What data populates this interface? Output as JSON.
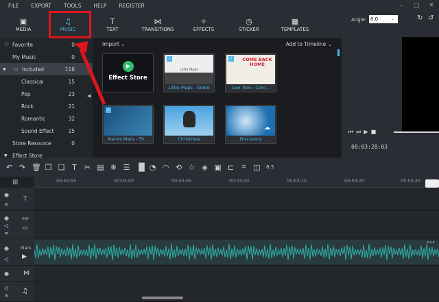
{
  "menu": [
    "FILE",
    "EXPORT",
    "TOOLS",
    "HELP",
    "REGISTER"
  ],
  "window_controls": [
    "minimize-icon",
    "maximize-icon",
    "close-icon"
  ],
  "tabs": [
    {
      "label": "MEDIA",
      "icon": "folder-icon"
    },
    {
      "label": "MUSIC",
      "icon": "music-note-icon"
    },
    {
      "label": "TEXT",
      "icon": "text-icon"
    },
    {
      "label": "TRANSITIONS",
      "icon": "bowtie-icon"
    },
    {
      "label": "EFFECTS",
      "icon": "sparkle-icon"
    },
    {
      "label": "STICKER",
      "icon": "clock-icon"
    },
    {
      "label": "TEMPLATES",
      "icon": "grid-icon"
    }
  ],
  "sidebar": [
    {
      "label": "Favorite",
      "count": "0",
      "icon": "heart-icon"
    },
    {
      "label": "My Music",
      "count": "0"
    },
    {
      "label": "Included",
      "count": "116",
      "icon": "folder-icon",
      "selected": true
    },
    {
      "label": "Classical",
      "count": "15",
      "sub": true
    },
    {
      "label": "Pop",
      "count": "23",
      "sub": true
    },
    {
      "label": "Rock",
      "count": "21",
      "sub": true
    },
    {
      "label": "Romantic",
      "count": "32",
      "sub": true
    },
    {
      "label": "Sound Effect",
      "count": "25",
      "sub": true
    },
    {
      "label": "Store Resource",
      "count": "0"
    },
    {
      "label": "Effect Store",
      "count": ""
    }
  ],
  "library": {
    "import": "Import",
    "add_to_timeline": "Add to Timeline",
    "items": [
      {
        "caption": "Effect Store",
        "tile_text": "Effect Store"
      },
      {
        "caption": "Little Maps - Eddie",
        "tile_text": "Little Maps"
      },
      {
        "caption": "Low Tree - Com...",
        "tile_text": "COME BACK HOME"
      },
      {
        "caption": "Manos Mars - Th...",
        "tile_text": ""
      },
      {
        "caption": "Christmas",
        "tile_text": ""
      },
      {
        "caption": "Discovery",
        "tile_text": ""
      }
    ]
  },
  "preview": {
    "angle_label": "Angle:",
    "angle_value": "0.0",
    "timecode": "00:03:28:03"
  },
  "toolbar": {
    "grid_label": "8:3"
  },
  "ruler": [
    "00:02:55",
    "00:03:00",
    "00:03:05",
    "00:03:10",
    "00:03:15",
    "00:03:20",
    "00:03:25"
  ],
  "tracks": [
    {
      "label": "T"
    },
    {
      "label": "PIP"
    },
    {
      "label": "Main"
    },
    {
      "label": ""
    },
    {
      "label": ""
    }
  ],
  "colors": {
    "accent": "#4db6e8",
    "highlight": "#e0161e",
    "waveform": "#2fa5a0"
  }
}
